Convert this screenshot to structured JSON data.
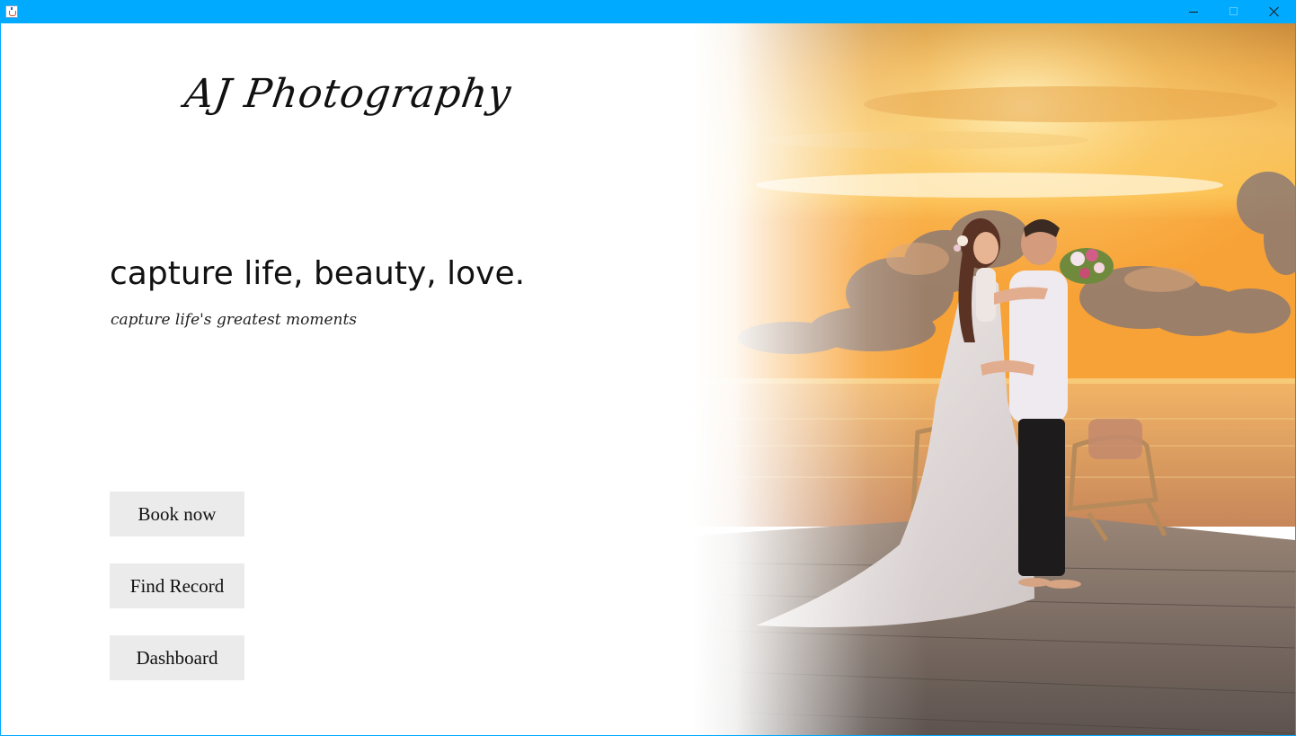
{
  "window": {
    "icon": "java-cup-icon",
    "controls": {
      "minimize": "minimize-icon",
      "maximize": "maximize-icon",
      "close": "close-icon"
    },
    "accent_color": "#00aaff"
  },
  "brand": {
    "logo_text": "AJ Photography"
  },
  "hero": {
    "headline": "capture life, beauty, love.",
    "tagline": "capture life's greatest moments"
  },
  "actions": {
    "book_now": "Book now",
    "find_record": "Find Record",
    "dashboard": "Dashboard"
  },
  "colors": {
    "button_bg": "#ebebeb",
    "sky_top": "#f3a53a",
    "sun": "#ffe79a",
    "sea": "#e9a659",
    "deck": "#7a6f68"
  }
}
